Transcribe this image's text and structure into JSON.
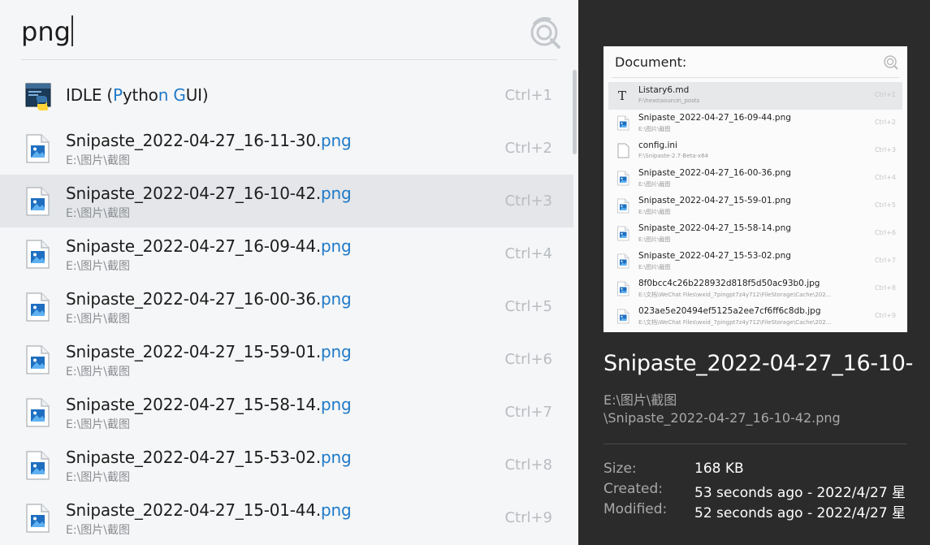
{
  "search": {
    "value": "png"
  },
  "results": [
    {
      "title_parts": [
        {
          "t": "IDLE (",
          "hl": false
        },
        {
          "t": "P",
          "hl": true
        },
        {
          "t": "ytho",
          "hl": false
        },
        {
          "t": "n",
          "hl": true
        },
        {
          "t": " ",
          "hl": false
        },
        {
          "t": "G",
          "hl": true
        },
        {
          "t": "UI)",
          "hl": false
        }
      ],
      "subtitle": "",
      "shortcut": "Ctrl+1",
      "icon": "python-idle-icon"
    },
    {
      "title_parts": [
        {
          "t": "Snipaste_2022-04-27_16-11-30.",
          "hl": false
        },
        {
          "t": "png",
          "hl": true
        }
      ],
      "subtitle": "E:\\图片\\截图",
      "shortcut": "Ctrl+2",
      "icon": "image-file-icon"
    },
    {
      "title_parts": [
        {
          "t": "Snipaste_2022-04-27_16-10-42.",
          "hl": false
        },
        {
          "t": "png",
          "hl": true
        }
      ],
      "subtitle": "E:\\图片\\截图",
      "shortcut": "Ctrl+3",
      "icon": "image-file-icon",
      "selected": true
    },
    {
      "title_parts": [
        {
          "t": "Snipaste_2022-04-27_16-09-44.",
          "hl": false
        },
        {
          "t": "png",
          "hl": true
        }
      ],
      "subtitle": "E:\\图片\\截图",
      "shortcut": "Ctrl+4",
      "icon": "image-file-icon"
    },
    {
      "title_parts": [
        {
          "t": "Snipaste_2022-04-27_16-00-36.",
          "hl": false
        },
        {
          "t": "png",
          "hl": true
        }
      ],
      "subtitle": "E:\\图片\\截图",
      "shortcut": "Ctrl+5",
      "icon": "image-file-icon"
    },
    {
      "title_parts": [
        {
          "t": "Snipaste_2022-04-27_15-59-01.",
          "hl": false
        },
        {
          "t": "png",
          "hl": true
        }
      ],
      "subtitle": "E:\\图片\\截图",
      "shortcut": "Ctrl+6",
      "icon": "image-file-icon"
    },
    {
      "title_parts": [
        {
          "t": "Snipaste_2022-04-27_15-58-14.",
          "hl": false
        },
        {
          "t": "png",
          "hl": true
        }
      ],
      "subtitle": "E:\\图片\\截图",
      "shortcut": "Ctrl+7",
      "icon": "image-file-icon"
    },
    {
      "title_parts": [
        {
          "t": "Snipaste_2022-04-27_15-53-02.",
          "hl": false
        },
        {
          "t": "png",
          "hl": true
        }
      ],
      "subtitle": "E:\\图片\\截图",
      "shortcut": "Ctrl+8",
      "icon": "image-file-icon"
    },
    {
      "title_parts": [
        {
          "t": "Snipaste_2022-04-27_15-01-44.",
          "hl": false
        },
        {
          "t": "png",
          "hl": true
        }
      ],
      "subtitle": "E:\\图片\\截图",
      "shortcut": "Ctrl+9",
      "icon": "image-file-icon"
    }
  ],
  "preview": {
    "thumbnail": {
      "title": "Document:",
      "rows": [
        {
          "title": "Listary6.md",
          "sub": "F:\\hexo\\source\\_posts",
          "sc": "Ctrl+1",
          "icon": "text-file-icon",
          "sel": true
        },
        {
          "title": "Snipaste_2022-04-27_16-09-44.png",
          "sub": "E:\\图片\\截图",
          "sc": "Ctrl+2",
          "icon": "image-file-icon"
        },
        {
          "title": "config.ini",
          "sub": "F:\\Snipaste-2.7-Beta-x64",
          "sc": "Ctrl+3",
          "icon": "blank-file-icon"
        },
        {
          "title": "Snipaste_2022-04-27_16-00-36.png",
          "sub": "E:\\图片\\截图",
          "sc": "Ctrl+4",
          "icon": "image-file-icon"
        },
        {
          "title": "Snipaste_2022-04-27_15-59-01.png",
          "sub": "E:\\图片\\截图",
          "sc": "Ctrl+5",
          "icon": "image-file-icon"
        },
        {
          "title": "Snipaste_2022-04-27_15-58-14.png",
          "sub": "E:\\图片\\截图",
          "sc": "Ctrl+6",
          "icon": "image-file-icon"
        },
        {
          "title": "Snipaste_2022-04-27_15-53-02.png",
          "sub": "E:\\图片\\截图",
          "sc": "Ctrl+7",
          "icon": "image-file-icon"
        },
        {
          "title": "8f0bcc4c26b228932d818f5d50ac93b0.jpg",
          "sub": "E:\\文档\\WeChat Files\\wxid_7pingpt7z4y712\\FileStorage\\Cache\\202...",
          "sc": "Ctrl+8",
          "icon": "image-file-icon"
        },
        {
          "title": "023ae5e20494ef5125a2ee7cf6ff6c8db.jpg",
          "sub": "E:\\文档\\WeChat Files\\wxid_7pingpt7z4y712\\FileStorage\\Cache\\202...",
          "sc": "Ctrl+9",
          "icon": "image-file-icon"
        }
      ]
    },
    "name": "Snipaste_2022-04-27_16-10-",
    "path_line1": "E:\\图片\\截图",
    "path_line2": "\\Snipaste_2022-04-27_16-10-42.png",
    "meta": [
      {
        "label": "Size:",
        "value": "168 KB"
      },
      {
        "label": "Created:",
        "value": "53 seconds ago - 2022/4/27 星"
      },
      {
        "label": "Modified:",
        "value": "52 seconds ago - 2022/4/27 星"
      }
    ]
  },
  "colors": {
    "highlight": "#1e7ac8",
    "selected_row": "#e4e6e9",
    "preview_bg": "#2b2b2b"
  }
}
